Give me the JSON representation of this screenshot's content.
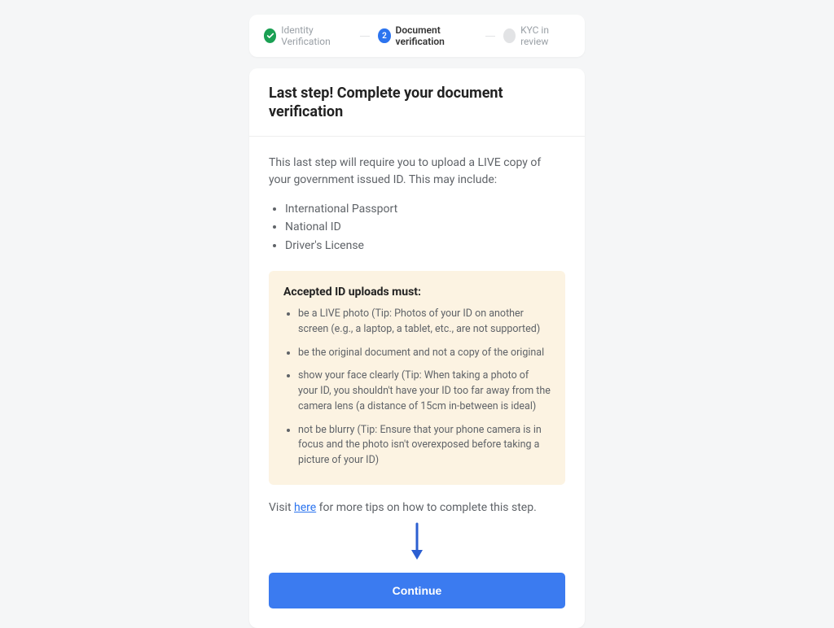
{
  "stepper": {
    "step1": {
      "label": "Identity Verification"
    },
    "step2": {
      "number": "2",
      "label": "Document verification"
    },
    "step3": {
      "label": "KYC in review"
    }
  },
  "card": {
    "title": "Last step! Complete your document verification",
    "intro": "This last step will require you to upload a LIVE copy of your government issued ID. This may include:",
    "id_types": {
      "0": "International Passport",
      "1": "National ID",
      "2": "Driver's License"
    },
    "info": {
      "title": "Accepted ID uploads must:",
      "items": {
        "0": "be a LIVE photo (Tip: Photos of your ID on another screen (e.g., a laptop, a tablet, etc., are not supported)",
        "1": "be the original document and not a copy of the original",
        "2": "show your face clearly (Tip: When taking a photo of your ID, you shouldn't have your ID too far away from the camera lens (a distance of 15cm in-between is ideal)",
        "3": "not be blurry (Tip: Ensure that your phone camera is in focus and the photo isn't overexposed before taking a picture of your ID)"
      }
    },
    "visit_prefix": "Visit ",
    "visit_link": "here",
    "visit_suffix": " for more tips on how to complete this step.",
    "continue_label": "Continue"
  }
}
